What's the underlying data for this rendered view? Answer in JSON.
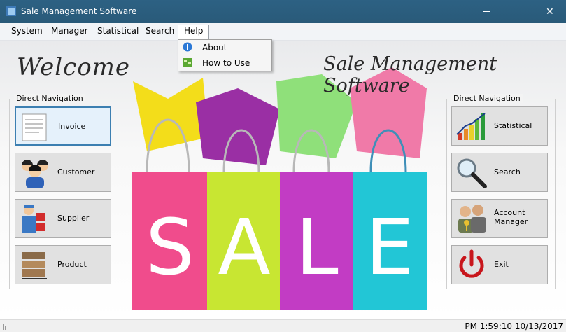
{
  "window": {
    "title": "Sale Management Software"
  },
  "menubar": {
    "items": [
      {
        "label": "System"
      },
      {
        "label": "Manager"
      },
      {
        "label": "Statistical"
      },
      {
        "label": "Search"
      },
      {
        "label": "Help"
      }
    ]
  },
  "help_menu": {
    "items": [
      {
        "label": "About",
        "icon": "info-icon"
      },
      {
        "label": "How to Use",
        "icon": "howto-icon"
      }
    ]
  },
  "banner": {
    "welcome": "Welcome",
    "brand": "Sale Management Software",
    "sale_letters": [
      "S",
      "A",
      "L",
      "E"
    ]
  },
  "left_nav": {
    "title": "Direct Navigation",
    "buttons": [
      {
        "label": "Invoice",
        "icon": "invoice-icon"
      },
      {
        "label": "Customer",
        "icon": "customer-icon"
      },
      {
        "label": "Supplier",
        "icon": "supplier-icon"
      },
      {
        "label": "Product",
        "icon": "product-icon"
      }
    ]
  },
  "right_nav": {
    "title": "Direct Navigation",
    "buttons": [
      {
        "label": "Statistical",
        "icon": "chart-icon"
      },
      {
        "label": "Search",
        "icon": "magnifier-icon"
      },
      {
        "label": "Account\nManager",
        "icon": "account-icon"
      },
      {
        "label": "Exit",
        "icon": "power-icon"
      }
    ]
  },
  "status": {
    "datetime": "PM 1:59:10 10/13/2017"
  },
  "colors": {
    "titlebar": "#2b5f7e",
    "bag_pink": "#f04c8c",
    "bag_lime": "#c8e632",
    "bag_purple": "#c23cc4",
    "bag_cyan": "#22c6d6",
    "exit_red": "#c8161c",
    "focus_border": "#3c7fb1"
  }
}
